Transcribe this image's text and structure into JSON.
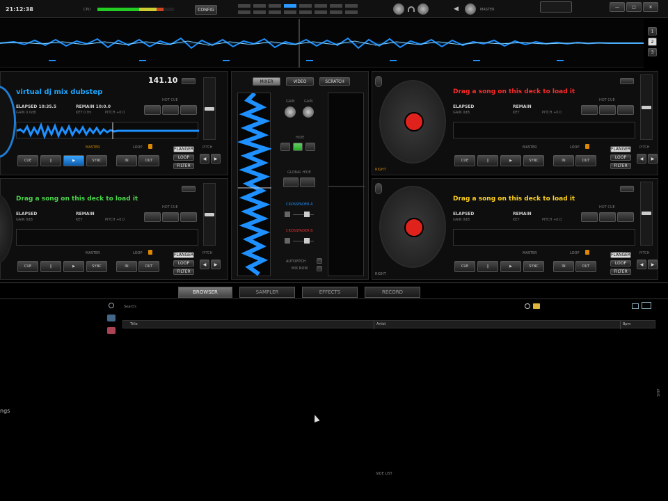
{
  "topbar": {
    "clock": "21:12:38",
    "cpu_label": "CPU",
    "config_label": "CONFIG",
    "master_label": "MASTER",
    "minimize_label": "—",
    "maximize_label": "□",
    "close_label": "✕",
    "deck_selectors": [
      "1",
      "2",
      "3"
    ]
  },
  "decks": [
    {
      "bpm": "141.10",
      "title": "virtual dj mix dubstep",
      "title_color": "#1ea7ff",
      "elapsed_label": "ELAPSED 10:35.5",
      "remain_label": "REMAIN 10:0.0",
      "gain_label": "GAIN 0.0dB",
      "key_label": "KEY 0 fm",
      "pitch_label": "PITCH +0.0",
      "hotcue_label": "HOT CUE",
      "master_label": "MASTER",
      "loop_label": "LOOP",
      "pitch_title": "PITCH",
      "buttons": [
        "CUE",
        "||",
        "▶",
        "SYNC"
      ],
      "loop_buttons": [
        "IN",
        "OUT"
      ],
      "side_buttons": [
        "FLANGER",
        "LOOP",
        "FILTER"
      ],
      "loaded": true
    },
    {
      "bpm": "",
      "title": "Drag a song on this deck to load it",
      "title_color": "#ff2a2a",
      "elapsed_label": "ELAPSED",
      "remain_label": "REMAIN",
      "gain_label": "GAIN 0dB",
      "key_label": "KEY",
      "pitch_label": "PITCH +0.0",
      "hotcue_label": "HOT CUE",
      "master_label": "MASTER",
      "loop_label": "LOOP",
      "pitch_title": "PITCH",
      "buttons": [
        "CUE",
        "||",
        "▶",
        "SYNC"
      ],
      "loop_buttons": [
        "IN",
        "OUT"
      ],
      "side_buttons": [
        "FLANGER",
        "LOOP",
        "FILTER"
      ],
      "loaded": false
    },
    {
      "bpm": "",
      "title": "Drag a song on this deck to load it",
      "title_color": "#4cd64c",
      "elapsed_label": "ELAPSED",
      "remain_label": "REMAIN",
      "gain_label": "GAIN 0dB",
      "key_label": "KEY",
      "pitch_label": "PITCH +0.0",
      "hotcue_label": "HOT CUE",
      "master_label": "MASTER",
      "loop_label": "LOOP",
      "pitch_title": "PITCH",
      "buttons": [
        "CUE",
        "||",
        "▶",
        "SYNC"
      ],
      "loop_buttons": [
        "IN",
        "OUT"
      ],
      "side_buttons": [
        "FLANGER",
        "LOOP",
        "FILTER"
      ],
      "loaded": false
    },
    {
      "bpm": "",
      "title": "Drag a song on this deck to load it",
      "title_color": "#ffd21e",
      "elapsed_label": "ELAPSED",
      "remain_label": "REMAIN",
      "gain_label": "GAIN 0dB",
      "key_label": "KEY",
      "pitch_label": "PITCH +0.0",
      "hotcue_label": "HOT CUE",
      "master_label": "MASTER",
      "loop_label": "LOOP",
      "pitch_title": "PITCH",
      "buttons": [
        "CUE",
        "||",
        "▶",
        "SYNC"
      ],
      "loop_buttons": [
        "IN",
        "OUT"
      ],
      "side_buttons": [
        "FLANGER",
        "LOOP",
        "FILTER"
      ],
      "loaded": false
    }
  ],
  "right_deck_labels": [
    "RIGHT",
    "RIGHT"
  ],
  "mixer": {
    "modes": [
      "MIXER",
      "VIDEO",
      "SCRATCH"
    ],
    "gain_label": "GAIN",
    "hide_label": "HIDE",
    "global_label": "GLOBAL HIDE",
    "crossfader_a_label": "CROSSFADER A",
    "crossfader_b_label": "CROSSFADER B",
    "autoflag_label": "AUTOPITCH",
    "mix_label": "MIX NOW"
  },
  "browser": {
    "tabs": [
      "BROWSER",
      "SAMPLER",
      "EFFECTS",
      "RECORD"
    ],
    "search_label": "Search:",
    "columns": [
      "Title",
      "Artist",
      "Bpm"
    ],
    "left_label": "ngs",
    "footer_label": "SIDE LIST",
    "right_edge_label": "SHIP"
  },
  "colors": {
    "wave": "#1e90ff",
    "platter_center": "#e0221c"
  }
}
